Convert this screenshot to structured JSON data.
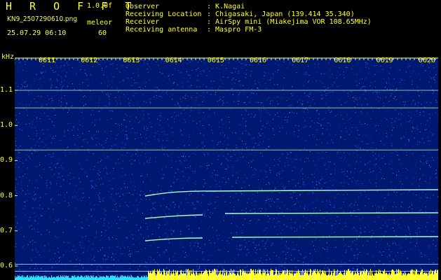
{
  "header": {
    "app_title": "H R O F F T",
    "version": "1.0.0f",
    "filename": "KN9_2507290610.png",
    "mode": "meleor",
    "datetime": "25.07.29 06:10",
    "count": "60",
    "info": [
      {
        "label": "Observer",
        "value": ": K.Nagai"
      },
      {
        "label": "Receiving Location",
        "value": ": Chigasaki, Japan (139.414 35.340)"
      },
      {
        "label": "Receiver",
        "value": ": AirSpy mini (Miakejima VOR 108.65MHz)"
      },
      {
        "label": "Receiving antenna",
        "value": ": Maspro FM-3"
      }
    ]
  },
  "spectrogram": {
    "freq_unit": "kHz",
    "freq_labels": [
      "1.1",
      "1.0",
      "0.9",
      "0.8",
      "0.7",
      "0.6"
    ],
    "time_labels": [
      "0611",
      "0612",
      "0613",
      "0614",
      "0615",
      "0616",
      "0617",
      "0618",
      "0619",
      "0620"
    ],
    "colors": {
      "background": "#001870",
      "noise": "#2a5cff",
      "signal": "#a8ffd0",
      "text": "#ffff33",
      "bottom_bar_left": "#33ddff",
      "bottom_bar_right": "#ffff33"
    }
  }
}
